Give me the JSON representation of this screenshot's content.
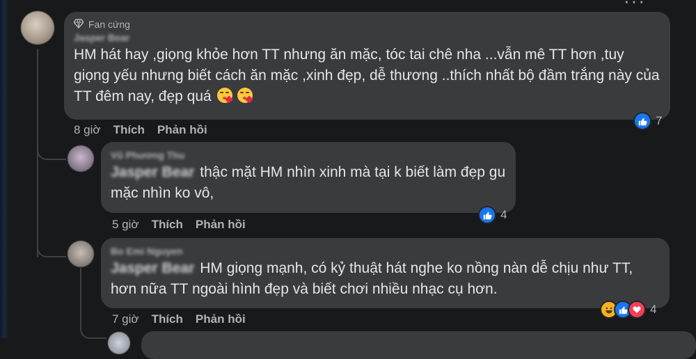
{
  "comments": [
    {
      "badge": "Fan cứng",
      "author": "Jasper Bear",
      "text": "HM hát hay ,giọng khỏe hơn TT nhưng ăn mặc, tóc tai chê nha ...vẫn mê TT hơn ,tuy giọng yếu nhưng biết cách ăn mặc ,xinh đẹp, dễ thương ..thích nhất bộ đầm trắng này của TT đêm nay, đẹp quá",
      "emoji": "face-blowing-kiss",
      "time": "8 giờ",
      "like_label": "Thích",
      "reply_label": "Phản hồi",
      "reaction_count": "7"
    },
    {
      "author": "Vũ Phương Thu",
      "mention": "Jasper Bear",
      "text": "thậc mặt HM nhìn xinh mà tại k biết làm đẹp gu mặc nhìn ko vô,",
      "time": "5 giờ",
      "like_label": "Thích",
      "reply_label": "Phản hồi",
      "reaction_count": "4"
    },
    {
      "author": "Bo Emi Nguyen",
      "mention": "Jasper Bear",
      "text": "HM giọng mạnh, có kỷ thuật hát nghe ko nồng nàn dễ chịu như TT, hơn nữa TT ngoài hình đẹp và biết chơi nhiều nhạc cụ hơn.",
      "time": "7 giờ",
      "like_label": "Thích",
      "reply_label": "Phản hồi",
      "reaction_count": "4"
    }
  ],
  "more_menu": "···",
  "colors": {
    "background": "#18191a",
    "bubble": "#3a3b3c",
    "like": "#1877f2",
    "love": "#f33e58",
    "haha": "#f7b125"
  }
}
